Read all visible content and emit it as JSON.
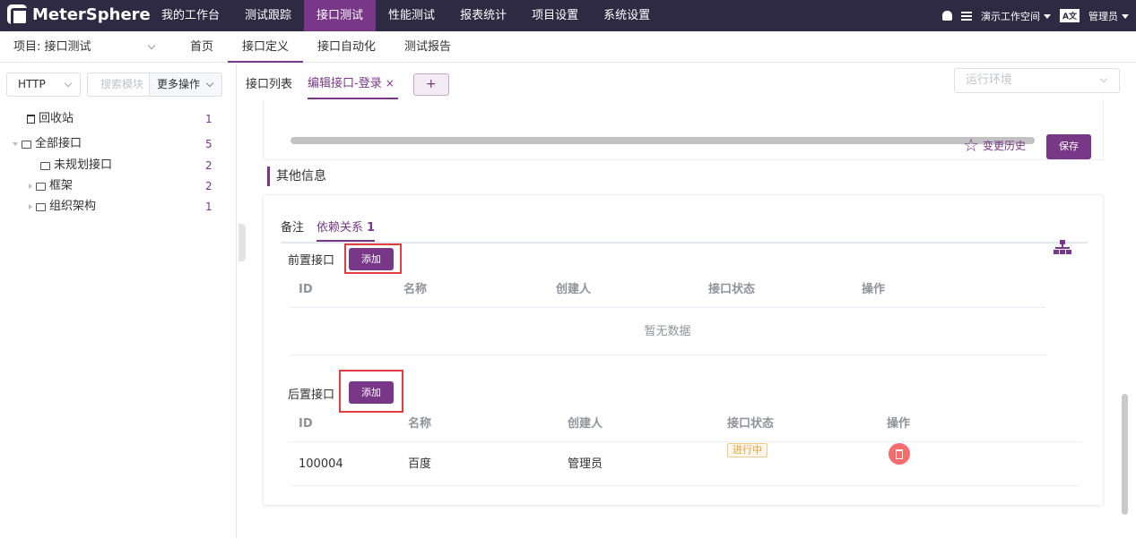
{
  "brand": {
    "name": "MeterSphere"
  },
  "top_menu": [
    "我的工作台",
    "测试跟踪",
    "接口测试",
    "性能测试",
    "报表统计",
    "项目设置",
    "系统设置"
  ],
  "top_right": {
    "workspace": "演示工作空间",
    "lang": "A文",
    "user": "管理员"
  },
  "subbar": {
    "project": "项目: 接口测试",
    "nav": [
      "首页",
      "接口定义",
      "接口自动化",
      "测试报告"
    ]
  },
  "sidebar": {
    "protocol": "HTTP",
    "search_placeholder": "搜索模块",
    "more_ops": "更多操作",
    "tree": [
      {
        "label": "回收站",
        "count": "1"
      },
      {
        "label": "全部接口",
        "count": "5"
      },
      {
        "label": "未规划接口",
        "count": "2"
      },
      {
        "label": "框架",
        "count": "2"
      },
      {
        "label": "组织架构",
        "count": "1"
      }
    ]
  },
  "tabs": {
    "list": "接口列表",
    "edit": "编辑接口-登录",
    "close": "×",
    "add": "+"
  },
  "env_placeholder": "运行环境",
  "toolbar": {
    "history": "变更历史",
    "save": "保存"
  },
  "section": {
    "title": "其他信息",
    "tab_note": "备注",
    "tab_dep": "依赖关系",
    "tab_dep_count": "1"
  },
  "pre": {
    "label": "前置接口",
    "add": "添加",
    "columns": [
      "ID",
      "名称",
      "创建人",
      "接口状态",
      "操作"
    ],
    "empty": "暂无数据"
  },
  "post": {
    "label": "后置接口",
    "add": "添加",
    "columns": [
      "ID",
      "名称",
      "创建人",
      "接口状态",
      "操作"
    ],
    "rows": [
      {
        "id": "100004",
        "name": "百度",
        "creator": "管理员",
        "status": "进行中"
      }
    ]
  },
  "colors": {
    "brand_purple": "#783887",
    "topbar": "#2f2a44",
    "status_orange": "#e6a23c",
    "danger": "#f56c6c"
  }
}
